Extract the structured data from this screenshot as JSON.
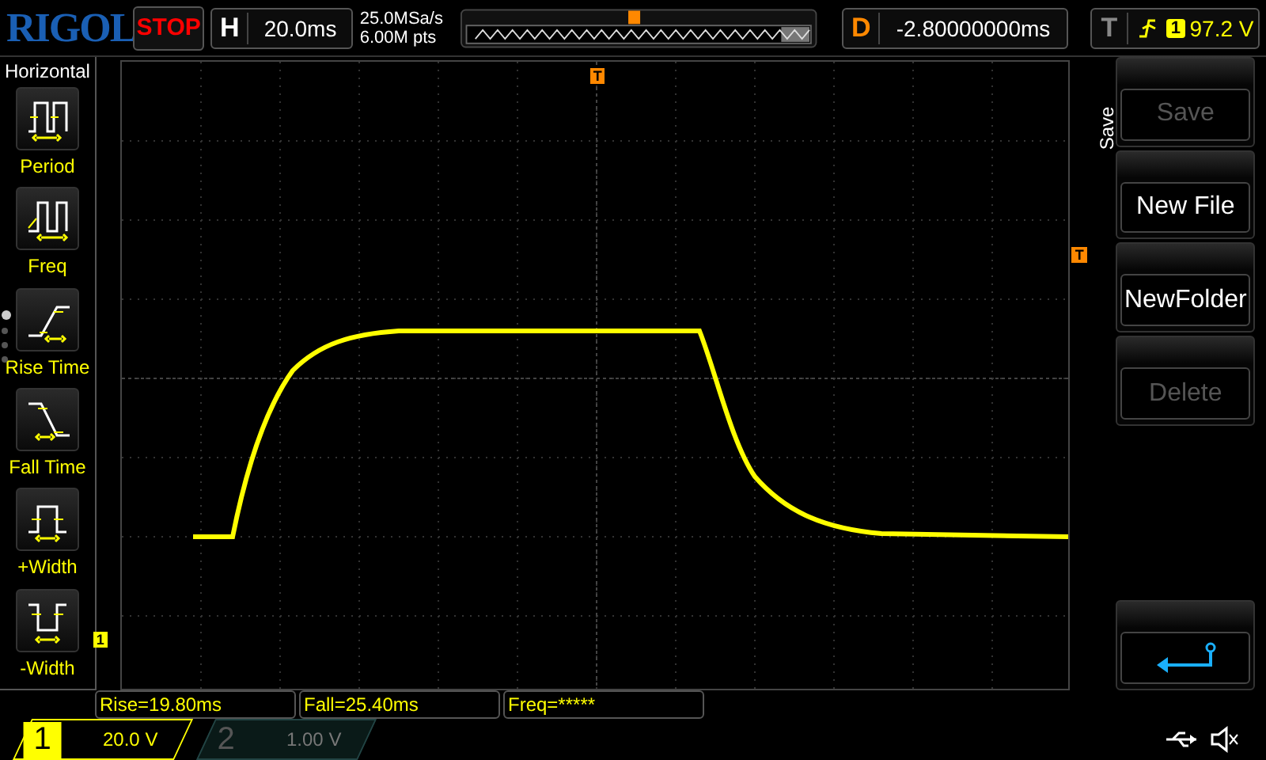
{
  "brand": "RIGOL",
  "run_state": "STOP",
  "horizontal": {
    "label": "H",
    "scale": "20.0ms"
  },
  "acquisition": {
    "sample_rate": "25.0MSa/s",
    "memory_depth": "6.00M pts"
  },
  "delay": {
    "label": "D",
    "value": "-2.80000000ms"
  },
  "trigger": {
    "label": "T",
    "source": "1",
    "level": "97.2 V"
  },
  "left_menu": {
    "title": "Horizontal",
    "items": [
      {
        "kind": "period",
        "label": "Period"
      },
      {
        "kind": "freq",
        "label": "Freq"
      },
      {
        "kind": "rise",
        "label": "Rise Time"
      },
      {
        "kind": "fall",
        "label": "Fall Time"
      },
      {
        "kind": "pwidth",
        "label": "+Width"
      },
      {
        "kind": "nwidth",
        "label": "-Width"
      }
    ],
    "pages": [
      {
        "selected": true
      },
      {
        "selected": false
      },
      {
        "selected": false
      },
      {
        "selected": false
      }
    ]
  },
  "screen_markers": {
    "trigger_position": "T",
    "trigger_level": "T",
    "channel": "1"
  },
  "right_menu": {
    "title": "Save",
    "buttons": [
      {
        "kind": "text",
        "label": "Save",
        "disabled": true
      },
      {
        "kind": "text",
        "label": "New File",
        "disabled": false
      },
      {
        "kind": "text",
        "label": "NewFolder",
        "disabled": false
      },
      {
        "kind": "text",
        "label": "Delete",
        "disabled": true
      },
      {
        "kind": "spacer"
      },
      {
        "kind": "back",
        "disabled": false
      }
    ]
  },
  "measurements": [
    "Rise=19.80ms",
    "Fall=25.40ms",
    "Freq=*****"
  ],
  "channels": [
    {
      "number": "1",
      "scale": "20.0 V",
      "on": true
    },
    {
      "number": "2",
      "scale": "1.00 V",
      "on": false
    }
  ]
}
